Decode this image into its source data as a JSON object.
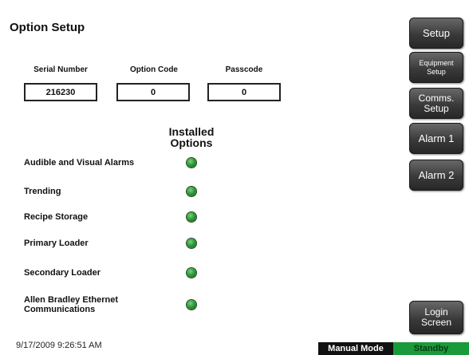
{
  "title": "Option Setup",
  "fields": {
    "serial_label": "Serial Number",
    "serial_value": "216230",
    "option_label": "Option Code",
    "option_value": "0",
    "passcode_label": "Passcode",
    "passcode_value": "0"
  },
  "installed_header": "Installed Options",
  "options": [
    {
      "label": "Audible and Visual Alarms",
      "installed": true
    },
    {
      "label": "Trending",
      "installed": true
    },
    {
      "label": "Recipe Storage",
      "installed": true
    },
    {
      "label": "Primary Loader",
      "installed": true
    },
    {
      "label": "Secondary Loader",
      "installed": true
    },
    {
      "label": "Allen Bradley Ethernet Communications",
      "installed": true
    }
  ],
  "nav": {
    "setup": "Setup",
    "equipment_setup": "Equipment Setup",
    "comms_setup": "Comms. Setup",
    "alarm1": "Alarm 1",
    "alarm2": "Alarm 2",
    "login_screen": "Login Screen"
  },
  "status": {
    "timestamp": "9/17/2009 9:26:51 AM",
    "mode": "Manual Mode",
    "state": "Standby"
  },
  "colors": {
    "led_on": "#2e9a3a",
    "standby": "#1a9a3a",
    "button": "#3a3a3a"
  }
}
